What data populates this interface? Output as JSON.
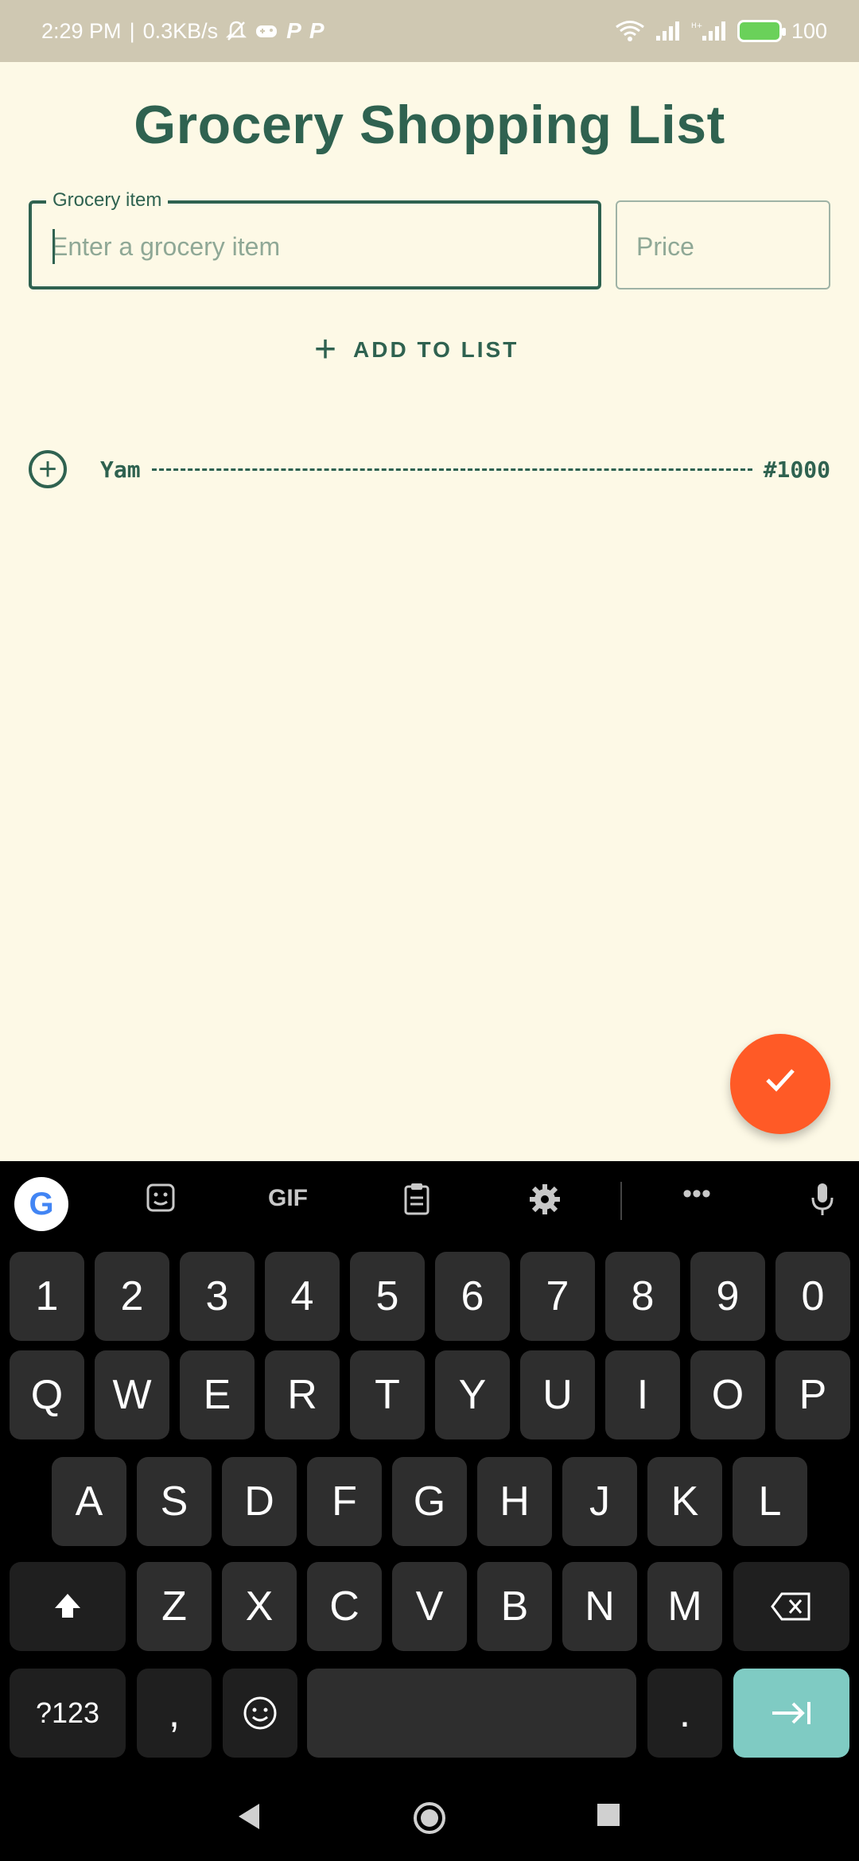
{
  "status_bar": {
    "time": "2:29 PM",
    "net_speed": "0.3KB/s",
    "app_letter_1": "P",
    "app_letter_2": "P",
    "battery": "100"
  },
  "app": {
    "title": "Grocery Shopping List",
    "item_field": {
      "label": "Grocery item",
      "placeholder": "Enter a grocery item",
      "value": ""
    },
    "price_field": {
      "placeholder": "Price",
      "value": ""
    },
    "add_button": {
      "label": "ADD TO LIST"
    },
    "items": [
      {
        "name": "Yam",
        "price": "#1000"
      }
    ]
  },
  "keyboard": {
    "toolbar": {
      "gif_label": "GIF",
      "more_label": "•••"
    },
    "row_numbers": [
      "1",
      "2",
      "3",
      "4",
      "5",
      "6",
      "7",
      "8",
      "9",
      "0"
    ],
    "row_1": [
      "Q",
      "W",
      "E",
      "R",
      "T",
      "Y",
      "U",
      "I",
      "O",
      "P"
    ],
    "row_2": [
      "A",
      "S",
      "D",
      "F",
      "G",
      "H",
      "J",
      "K",
      "L"
    ],
    "row_3": [
      "Z",
      "X",
      "C",
      "V",
      "B",
      "N",
      "M"
    ],
    "symbols_label": "?123",
    "comma": ",",
    "period": "."
  },
  "colors": {
    "primary": "#2f6250",
    "background": "#fdf9e6",
    "fab": "#ff5a26",
    "enter_key": "#7fcbc3"
  }
}
